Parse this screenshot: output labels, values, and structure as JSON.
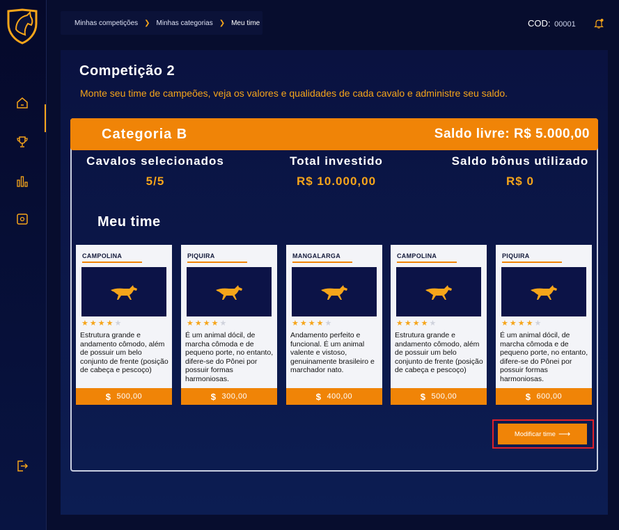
{
  "colors": {
    "accent": "#f08407",
    "accent_text": "#f6a51a",
    "background": "#070d2e",
    "panel": "#0a1240",
    "highlight": "#e0212a"
  },
  "sidebar": {
    "logo": "horse-shield-logo",
    "items": [
      {
        "icon": "home-icon"
      },
      {
        "icon": "trophy-icon"
      },
      {
        "icon": "bar-chart-icon"
      },
      {
        "icon": "safe-icon"
      },
      {
        "icon": "logout-icon"
      }
    ]
  },
  "breadcrumb": {
    "items": [
      "Minhas competições",
      "Minhas categorias",
      "Meu time"
    ]
  },
  "header": {
    "cod_label": "COD:",
    "cod_value": "00001",
    "notification_icon": "bell-icon"
  },
  "page": {
    "title": "Competição 2",
    "subtitle": "Monte seu time de campeões, veja os valores e qualidades de cada cavalo e administre seu saldo."
  },
  "category": {
    "title": "Categoria B",
    "saldo_livre": "Saldo livre: R$ 5.000,00"
  },
  "stats": [
    {
      "label": "Cavalos selecionados",
      "value": "5/5"
    },
    {
      "label": "Total investido",
      "value": "R$ 10.000,00"
    },
    {
      "label": "Saldo bônus utilizado",
      "value": "R$ 0"
    }
  ],
  "team": {
    "title": "Meu time",
    "cards": [
      {
        "breed": "CAMPOLINA",
        "stars": 4,
        "description": "Estrutura grande e andamento cômodo, além de possuir um belo conjunto de frente (posição de cabeça e pescoço)",
        "price": "500,00",
        "currency": "$"
      },
      {
        "breed": "PIQUIRA",
        "stars": 4,
        "description": "É um animal dócil, de marcha cômoda e de pequeno porte, no entanto, difere-se do Pônei por possuir formas harmoniosas.",
        "price": "300,00",
        "currency": "$"
      },
      {
        "breed": "MANGALARGA",
        "stars": 4,
        "description": "Andamento perfeito e funcional. É um animal valente e vistoso, genuinamente brasileiro e marchador nato.",
        "price": "400,00",
        "currency": "$"
      },
      {
        "breed": "CAMPOLINA",
        "stars": 4,
        "description": "Estrutura grande e andamento cômodo, além de possuir um belo conjunto de frente (posição de cabeça e pescoço)",
        "price": "500,00",
        "currency": "$"
      },
      {
        "breed": "PIQUIRA",
        "stars": 4,
        "description": "É um animal dócil, de marcha cômoda e de pequeno porte, no entanto, difere-se do Pônei por possuir formas harmoniosas.",
        "price": "600,00",
        "currency": "$"
      }
    ]
  },
  "actions": {
    "modify_label": "Modificar time",
    "modify_arrow": "⟶"
  }
}
